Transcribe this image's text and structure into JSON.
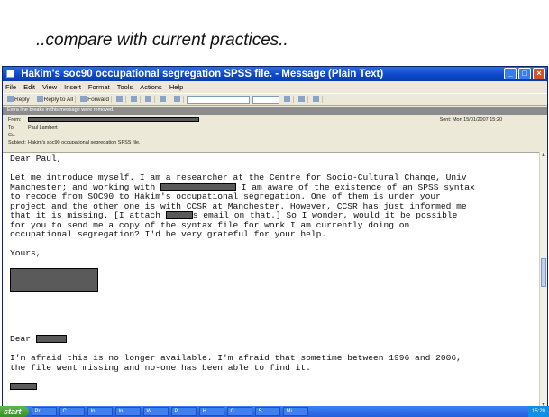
{
  "slide": {
    "title": "..compare with current practices.."
  },
  "window": {
    "title": "Hakim's soc90 occupational segregation SPSS file. - Message (Plain Text)",
    "buttons": {
      "minimize": "_",
      "maximize": "□",
      "close": "×"
    }
  },
  "menu": [
    "File",
    "Edit",
    "View",
    "Insert",
    "Format",
    "Tools",
    "Actions",
    "Help"
  ],
  "toolbar": {
    "reply": "Reply",
    "reply_all": "Reply to All",
    "forward": "Forward"
  },
  "infobar": "Extra line breaks in this message were removed.",
  "header": {
    "from_label": "From:",
    "to_label": "To:",
    "to_value": "Paul Lambert",
    "cc_label": "Cc:",
    "subject_label": "Subject:",
    "subject_value": "Hakim's soc90 occupational segregation SPSS file.",
    "sent_label": "Sent:",
    "sent_value": "Mon 15/01/2007 15:20"
  },
  "message": {
    "greeting": "Dear Paul,",
    "line1": "Let me introduce myself. I am a researcher at the Centre for Socio-Cultural Change, Univ",
    "line2a": "Manchester; and working with ",
    "line2b": " I am aware of the existence of an SPSS syntax",
    "line3": "to recode from SOC90 to Hakim's occupational segregation. One of them is under your",
    "line4": "project and the other one is with CCSR at Manchester. However, CCSR has just informed me",
    "line5a": "that it is missing. [I attach ",
    "line5b": "s email on that.] So I wonder, would it be possible",
    "line6": "for you to send me a copy of the syntax file for work I am currently doing on",
    "line7": "occupational segregation? I'd be very grateful for your help.",
    "signoff": "Yours,",
    "reply_greeting": "Dear ",
    "reply_line1": "I'm afraid this is no longer available. I'm afraid that sometime between 1996 and 2006,",
    "reply_line2": "the file went missing and no-one has been able to find it."
  },
  "taskbar": {
    "start": "start",
    "tasks": [
      "Pr...",
      "C...",
      "In...",
      "In...",
      "W...",
      "P...",
      "H...",
      "C...",
      "S...",
      "Mi..."
    ],
    "clock": "15:20"
  }
}
